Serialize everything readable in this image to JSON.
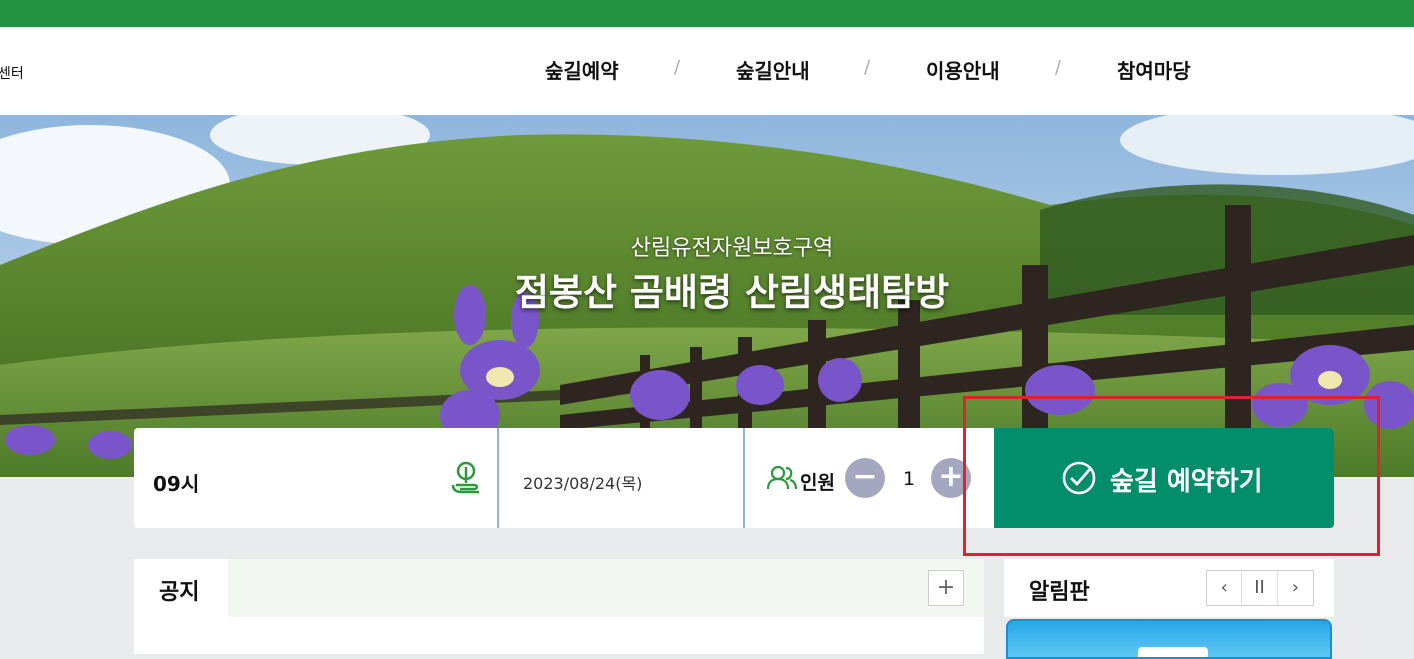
{
  "header": {
    "logo_fragment": "센터",
    "nav": [
      {
        "label": "숲길예약"
      },
      {
        "label": "숲길안내"
      },
      {
        "label": "이용안내"
      },
      {
        "label": "참여마당"
      }
    ],
    "separator": "/"
  },
  "hero": {
    "subtitle": "산림유전자원보호구역",
    "title": "점봉산 곰배령 산림생태탐방"
  },
  "booking": {
    "time": "09시",
    "date": "2023/08/24(목)",
    "people_label": "인원",
    "minus": "−",
    "plus": "+",
    "count": "1",
    "reserve_label": "숲길 예약하기"
  },
  "notice": {
    "tab_label": "공지",
    "more": "+"
  },
  "board": {
    "title": "알림판",
    "prev": "‹",
    "pause": "II",
    "next": "›"
  },
  "colors": {
    "topbar": "#23923f",
    "reserve_button": "#028d6b",
    "highlight": "#e1212f",
    "stepper": "#a5a7c0"
  },
  "icons": [
    "leaf-icon",
    "people-icon",
    "check-circle-icon"
  ]
}
